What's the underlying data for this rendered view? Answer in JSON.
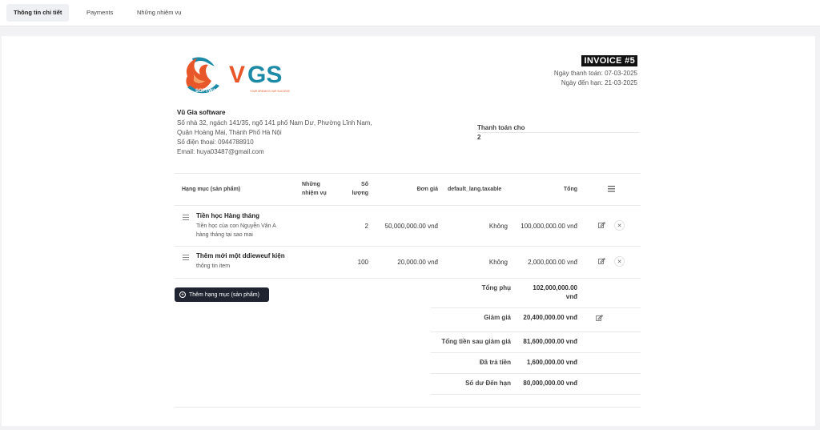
{
  "tabs": [
    {
      "label": "Thông tin chi tiết"
    },
    {
      "label": "Payments"
    },
    {
      "label": "Những nhiệm vụ"
    }
  ],
  "logo": {
    "text": "VGS",
    "badge": "SOFTWARE",
    "tagline": "YOUR DREAM IS OUR SUCCESS"
  },
  "company": {
    "name": "Vũ Gia software",
    "address_1": "Số nhà 32, ngách 141/35, ngõ 141 phố Nam Dư, Phường Lĩnh Nam,",
    "address_2": "Quận Hoàng Mai, Thành Phố Hà Nội",
    "phone": "Số điện thoại: 0944788910",
    "email": "Email: huya03487@gmail.com"
  },
  "invoice": {
    "title": "INVOICE #5",
    "payment_date": "Ngày thanh toán: 07-03-2025",
    "due_date": "Ngày đến hạn: 21-03-2025"
  },
  "bill_to": {
    "label": "Thanh toán cho",
    "value": "2"
  },
  "table": {
    "headers": {
      "item": "Hạng mục (sản phẩm)",
      "tasks_1": "Những",
      "tasks_2": "nhiệm vụ",
      "qty_1": "Số",
      "qty_2": "lượng",
      "price": "Đơn giá",
      "taxable": "default_lang.taxable",
      "total": "Tổng"
    },
    "rows": [
      {
        "name": "Tiền học Hàng tháng",
        "desc_1": "Tiền học của con Nguyễn Văn A",
        "desc_2": "hàng tháng tại sao mai",
        "qty": "2",
        "price": "50,000,000.00 vnđ",
        "taxable": "Không",
        "total": "100,000,000.00 vnđ"
      },
      {
        "name": "Thêm mới một ddieweuf kiện",
        "desc_1": "thông tin item",
        "desc_2": "",
        "qty": "100",
        "price": "20,000.00 vnđ",
        "taxable": "Không",
        "total": "2,000,000.00 vnđ"
      }
    ]
  },
  "add_item_label": "Thêm hạng mục (sản phẩm)",
  "summary": {
    "subtotal_label": "Tổng phụ",
    "subtotal_1": "102,000,000.00",
    "subtotal_2": "vnđ",
    "discount_label": "Giảm giá",
    "discount": "20,400,000.00 vnđ",
    "after_discount_label": "Tổng tiền sau giảm giá",
    "after_discount": "81,600,000.00 vnđ",
    "paid_label": "Đã trả tiền",
    "paid": "1,600,000.00 vnđ",
    "balance_label": "Số dư Đến hạn",
    "balance": "80,000,000.00 vnđ"
  },
  "colors": {
    "logo_orange": "#e8572a",
    "logo_teal": "#1c8aa6",
    "button_dark": "#1f2430"
  },
  "icons": {
    "edit": "edit-icon",
    "remove": "close-icon",
    "menu": "hamburger-icon",
    "drag": "drag-handle-icon",
    "add": "plus-circle-icon"
  }
}
